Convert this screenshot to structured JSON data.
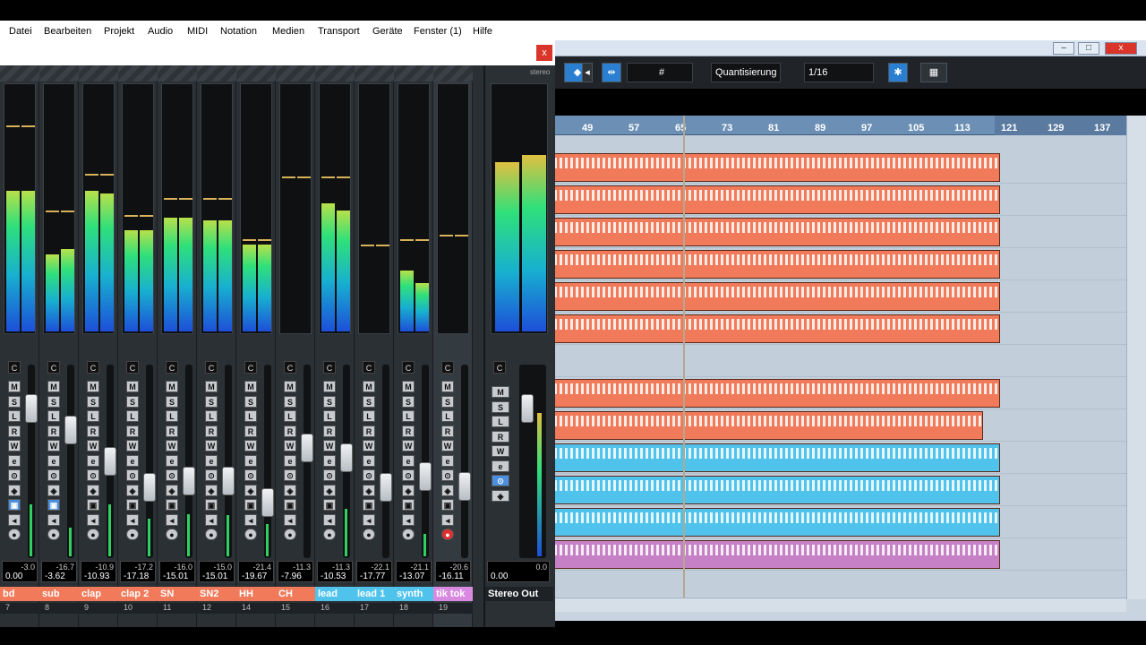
{
  "menubar": {
    "items": [
      "Datei",
      "Bearbeiten",
      "Projekt",
      "Audio",
      "MIDI",
      "Notation",
      "Medien",
      "Transport",
      "Geräte",
      "Fenster (1)",
      "Hilfe"
    ]
  },
  "mixer": {
    "close_label": "x",
    "stereo_label": "stereo",
    "channels": [
      {
        "name": "bd",
        "num": "7",
        "peak": "-3.0",
        "volume": "0.00",
        "color": "#f07a5a",
        "meter": [
          0.58,
          0.58
        ],
        "peakpos": 0.85,
        "fader": 0.82
      },
      {
        "name": "sub",
        "num": "8",
        "peak": "-16.7",
        "volume": "-3.62",
        "color": "#f07a5a",
        "meter": [
          0.32,
          0.34
        ],
        "peakpos": 0.5,
        "fader": 0.69
      },
      {
        "name": "clap",
        "num": "9",
        "peak": "-10.9",
        "volume": "-10.93",
        "color": "#f07a5a",
        "meter": [
          0.58,
          0.57
        ],
        "peakpos": 0.65,
        "fader": 0.5
      },
      {
        "name": "clap 2",
        "num": "10",
        "peak": "-17.2",
        "volume": "-17.18",
        "color": "#f07a5a",
        "meter": [
          0.42,
          0.42
        ],
        "peakpos": 0.48,
        "fader": 0.34
      },
      {
        "name": "SN",
        "num": "11",
        "peak": "-16.0",
        "volume": "-15.01",
        "color": "#f07a5a",
        "meter": [
          0.47,
          0.47
        ],
        "peakpos": 0.55,
        "fader": 0.38
      },
      {
        "name": "SN2",
        "num": "12",
        "peak": "-15.0",
        "volume": "-15.01",
        "color": "#f07a5a",
        "meter": [
          0.46,
          0.46
        ],
        "peakpos": 0.55,
        "fader": 0.38
      },
      {
        "name": "HH",
        "num": "14",
        "peak": "-21.4",
        "volume": "-19.67",
        "color": "#f07a5a",
        "meter": [
          0.36,
          0.36
        ],
        "peakpos": 0.38,
        "fader": 0.25
      },
      {
        "name": "CH",
        "num": "15",
        "peak": "-11.3",
        "volume": "-7.96",
        "color": "#f07a5a",
        "meter": [
          0.0,
          0.0
        ],
        "peakpos": 0.64,
        "fader": 0.58
      },
      {
        "name": "lead",
        "num": "16",
        "peak": "-11.3",
        "volume": "-10.53",
        "color": "#4fc3ec",
        "meter": [
          0.53,
          0.5
        ],
        "peakpos": 0.64,
        "fader": 0.52
      },
      {
        "name": "lead 1",
        "num": "17",
        "peak": "-22.1",
        "volume": "-17.77",
        "color": "#4fc3ec",
        "meter": [
          0.0,
          0.0
        ],
        "peakpos": 0.36,
        "fader": 0.34
      },
      {
        "name": "synth",
        "num": "18",
        "peak": "-21.1",
        "volume": "-13.07",
        "color": "#4fc3ec",
        "meter": [
          0.25,
          0.2
        ],
        "peakpos": 0.38,
        "fader": 0.41
      },
      {
        "name": "tik tok",
        "num": "19",
        "peak": "-20.6",
        "volume": "-16.11",
        "color": "#d98ae0",
        "meter": [
          0.0,
          0.0
        ],
        "peakpos": 0.4,
        "fader": 0.35
      }
    ],
    "stereo_out": {
      "name": "Stereo Out",
      "peak": "0.0",
      "volume": "0.00",
      "meter": [
        0.7,
        0.73
      ],
      "fader": 0.82
    }
  },
  "project": {
    "toolbar": {
      "quantize_label": "Quantisierung",
      "quantize_value": "1/16",
      "grid_glyph": "#"
    },
    "ruler": [
      "49",
      "57",
      "65",
      "73",
      "81",
      "89",
      "97",
      "105",
      "113",
      "121",
      "129",
      "137"
    ],
    "tracks": [
      {
        "color": "#f07a5a",
        "start": 0,
        "end": 0.78
      },
      {
        "color": "#f07a5a",
        "start": 0,
        "end": 0.78
      },
      {
        "color": "#f07a5a",
        "start": 0,
        "end": 0.78
      },
      {
        "color": "#f07a5a",
        "start": 0,
        "end": 0.78
      },
      {
        "color": "#f07a5a",
        "start": 0,
        "end": 0.78
      },
      {
        "color": "#f07a5a",
        "start": 0,
        "end": 0.78
      },
      {
        "color": "",
        "start": 0,
        "end": 0
      },
      {
        "color": "#f07a5a",
        "start": 0,
        "end": 0.78
      },
      {
        "color": "#f07a5a",
        "start": 0,
        "end": 0.75
      },
      {
        "color": "#4fc3ec",
        "start": 0,
        "end": 0.78
      },
      {
        "color": "#4fc3ec",
        "start": 0,
        "end": 0.78
      },
      {
        "color": "#4fc3ec",
        "start": 0,
        "end": 0.78
      },
      {
        "color": "#c580c6",
        "start": 0,
        "end": 0.78
      }
    ]
  }
}
